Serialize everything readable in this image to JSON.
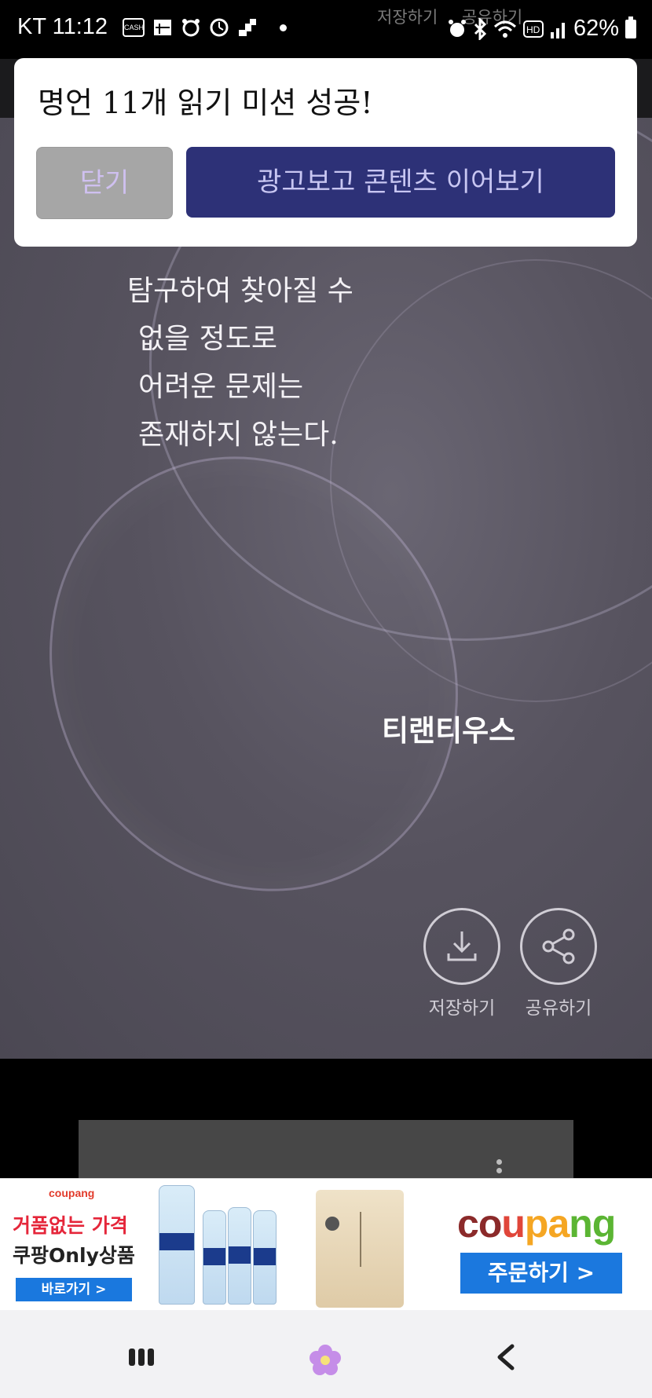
{
  "status_bar": {
    "carrier": "KT",
    "time": "11:12",
    "battery": "62%",
    "ghost_labels": [
      "저장하기",
      "공유하기"
    ]
  },
  "popup": {
    "title": "명언 11개 읽기 미션 성공!",
    "close_label": "닫기",
    "watch_ad_label": "광고보고 콘텐츠 이어보기"
  },
  "quote": {
    "lines": [
      "탐구하여 찾아질 수",
      "없을 정도로",
      "어려운 문제는",
      "존재하지 않는다."
    ],
    "author": "티랜티우스"
  },
  "actions": {
    "save_label": "저장하기",
    "share_label": "공유하기"
  },
  "ad_banner": {
    "small_logo": "coupang",
    "line1": "거품없는 가격",
    "line2": "쿠팡Only상품",
    "go_label": "바로가기 >",
    "brand_logo_parts": [
      "c",
      "o",
      "u",
      "pa",
      "ng"
    ],
    "order_label": "주문하기 >"
  },
  "colors": {
    "popup_primary": "#2d3177",
    "popup_secondary": "#a6a6a6",
    "coupang_blue": "#1b78de"
  }
}
